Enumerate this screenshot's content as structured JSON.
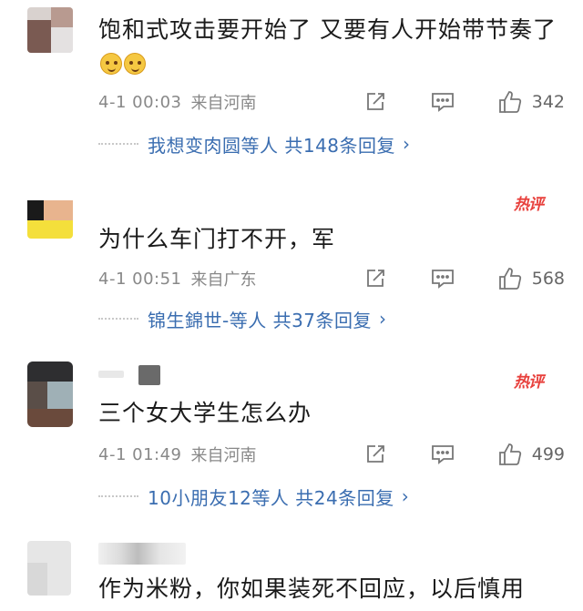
{
  "comments": [
    {
      "text": "饱和式攻击要开始了 又要有人开始带节奏了",
      "emoji": [
        "doge-emoji",
        "doge-emoji"
      ],
      "time": "4-1 00:03",
      "location": "来自河南",
      "likes": "342",
      "hot": "",
      "replies": "我想变肉圆等人 共148条回复"
    },
    {
      "text": "为什么车门打不开，军",
      "time": "4-1 00:51",
      "location": "来自广东",
      "likes": "568",
      "hot": "热评",
      "replies": "锦生錦世-等人 共37条回复"
    },
    {
      "text": "三个女大学生怎么办",
      "time": "4-1 01:49",
      "location": "来自河南",
      "likes": "499",
      "hot": "热评",
      "replies": "10小朋友12等人 共24条回复"
    },
    {
      "text": "作为米粉，你如果装死不回应，以后慎用"
    }
  ],
  "icons": {
    "share": "share-icon",
    "comment": "comment-icon",
    "like": "thumbs-up-icon",
    "chevron": "chevron-right-icon"
  },
  "colors": {
    "reply_link": "#3a6db0",
    "hot_badge": "#e8403c",
    "meta": "#888888"
  }
}
